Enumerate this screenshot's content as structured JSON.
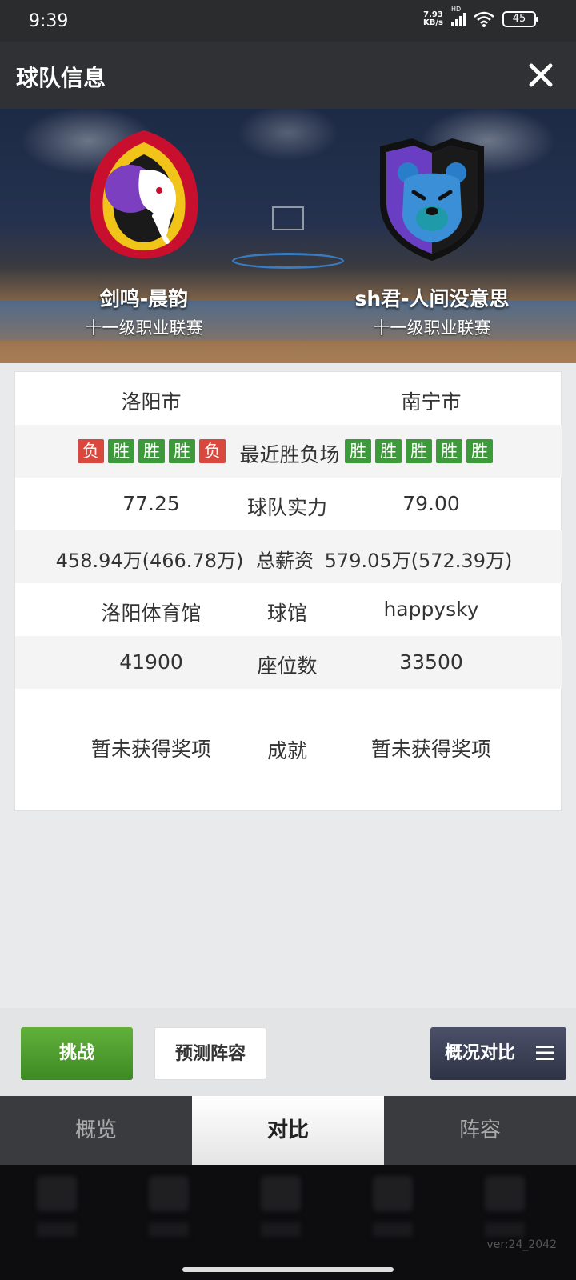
{
  "status": {
    "time": "9:39",
    "net_speed": "7.93",
    "net_unit": "KB/s",
    "hd": "HD",
    "battery": "45"
  },
  "header": {
    "title": "球队信息"
  },
  "teams": {
    "left": {
      "name": "剑鸣-晨韵",
      "league": "十一级职业联赛"
    },
    "right": {
      "name": "sh君-人间没意思",
      "league": "十一级职业联赛"
    }
  },
  "comparison": {
    "city": {
      "left": "洛阳市",
      "right": "南宁市"
    },
    "recent": {
      "label": "最近胜负场",
      "left": [
        "负",
        "胜",
        "胜",
        "胜",
        "负"
      ],
      "right": [
        "胜",
        "胜",
        "胜",
        "胜",
        "胜"
      ]
    },
    "strength": {
      "label": "球队实力",
      "left": "77.25",
      "right": "79.00"
    },
    "salary": {
      "label": "总薪资",
      "left": "458.94万(466.78万)",
      "right": "579.05万(572.39万)"
    },
    "arena": {
      "label": "球馆",
      "left": "洛阳体育馆",
      "right": "happysky"
    },
    "seats": {
      "label": "座位数",
      "left": "41900",
      "right": "33500"
    },
    "achievement": {
      "label": "成就",
      "left": "暂未获得奖项",
      "right": "暂未获得奖项"
    }
  },
  "actions": {
    "challenge": "挑战",
    "predict": "预测阵容",
    "compare": "概况对比"
  },
  "tabs": [
    "概览",
    "对比",
    "阵容"
  ],
  "active_tab": "对比",
  "version": "ver:24_2042",
  "colors": {
    "win": "#3d9a3a",
    "loss": "#d8483e",
    "challenge": "#4e9d2f",
    "header": "#2f3134"
  }
}
